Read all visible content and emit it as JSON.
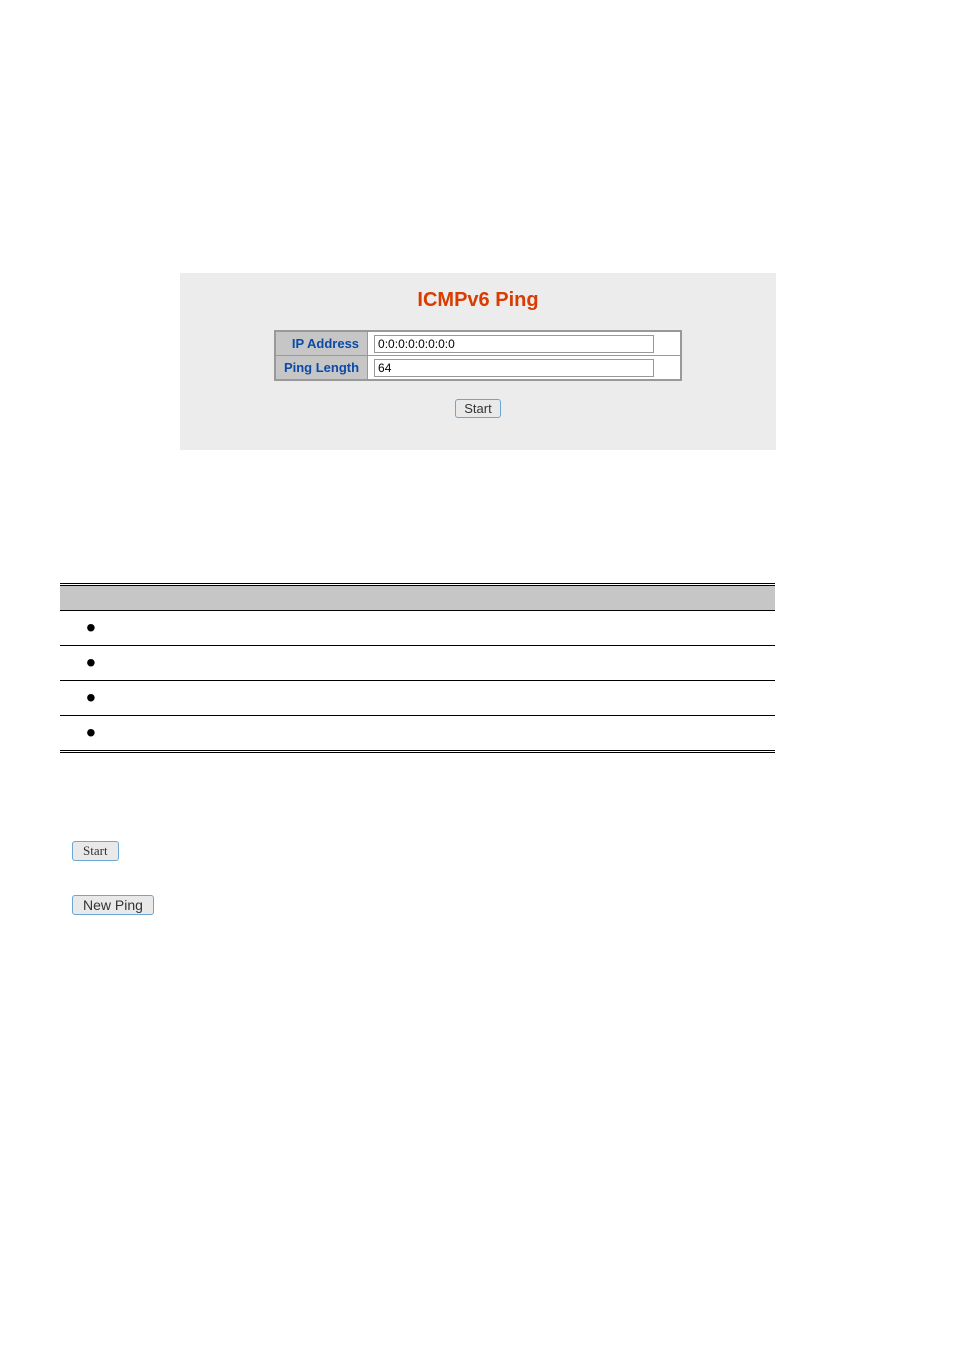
{
  "panel": {
    "title": "ICMPv6 Ping",
    "fields": {
      "ip_label": "IP Address",
      "ip_value": "0:0:0:0:0:0:0:0",
      "len_label": "Ping Length",
      "len_value": "64"
    },
    "start_label": "Start"
  },
  "buttons": {
    "start": "Start",
    "new_ping": "New Ping"
  }
}
